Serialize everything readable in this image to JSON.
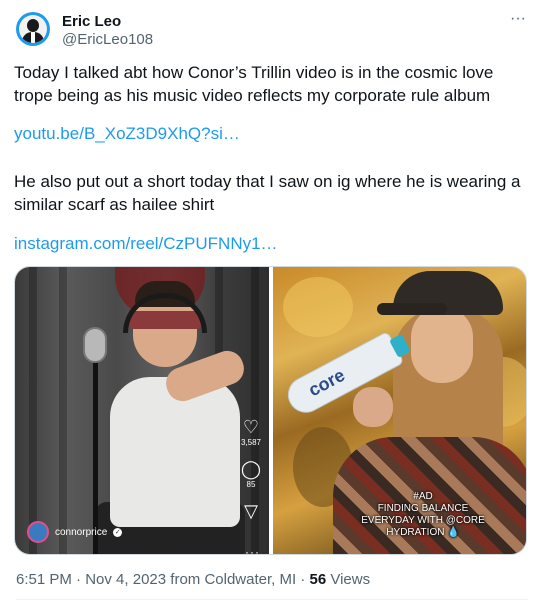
{
  "author": {
    "display_name": "Eric Leo",
    "handle": "@EricLeo108"
  },
  "tweet": {
    "paragraph_1": "Today I talked abt how Conor’s Trillin video is in the cosmic love trope being as his music video reflects my corporate rule album",
    "link_1": "youtu.be/B_XoZ3D9XhQ?si…",
    "paragraph_2": "He also put out a short today that I saw on ig where he is wearing a similar scarf as hailee shirt",
    "link_2": "instagram.com/reel/CzPUFNNy1…"
  },
  "media": {
    "left": {
      "icons": [
        "heart-icon",
        "comment-icon",
        "share-icon",
        "more-icon"
      ],
      "like_count": "3,587",
      "comment_count": "85",
      "username": "connorprice"
    },
    "right": {
      "bottle_label": "core",
      "caption_line_1": "#AD",
      "caption_line_2": "FINDING BALANCE",
      "caption_line_3": "EVERYDAY WITH @CORE",
      "caption_line_4": "HYDRATION 💧"
    }
  },
  "meta": {
    "time": "6:51 PM",
    "separator": " · ",
    "date": "Nov 4, 2023 from Coldwater, MI",
    "views_count": "56",
    "views_label": " Views"
  },
  "colors": {
    "link": "#1d9bf0",
    "secondary_text": "#536471",
    "primary_text": "#0f1419"
  }
}
